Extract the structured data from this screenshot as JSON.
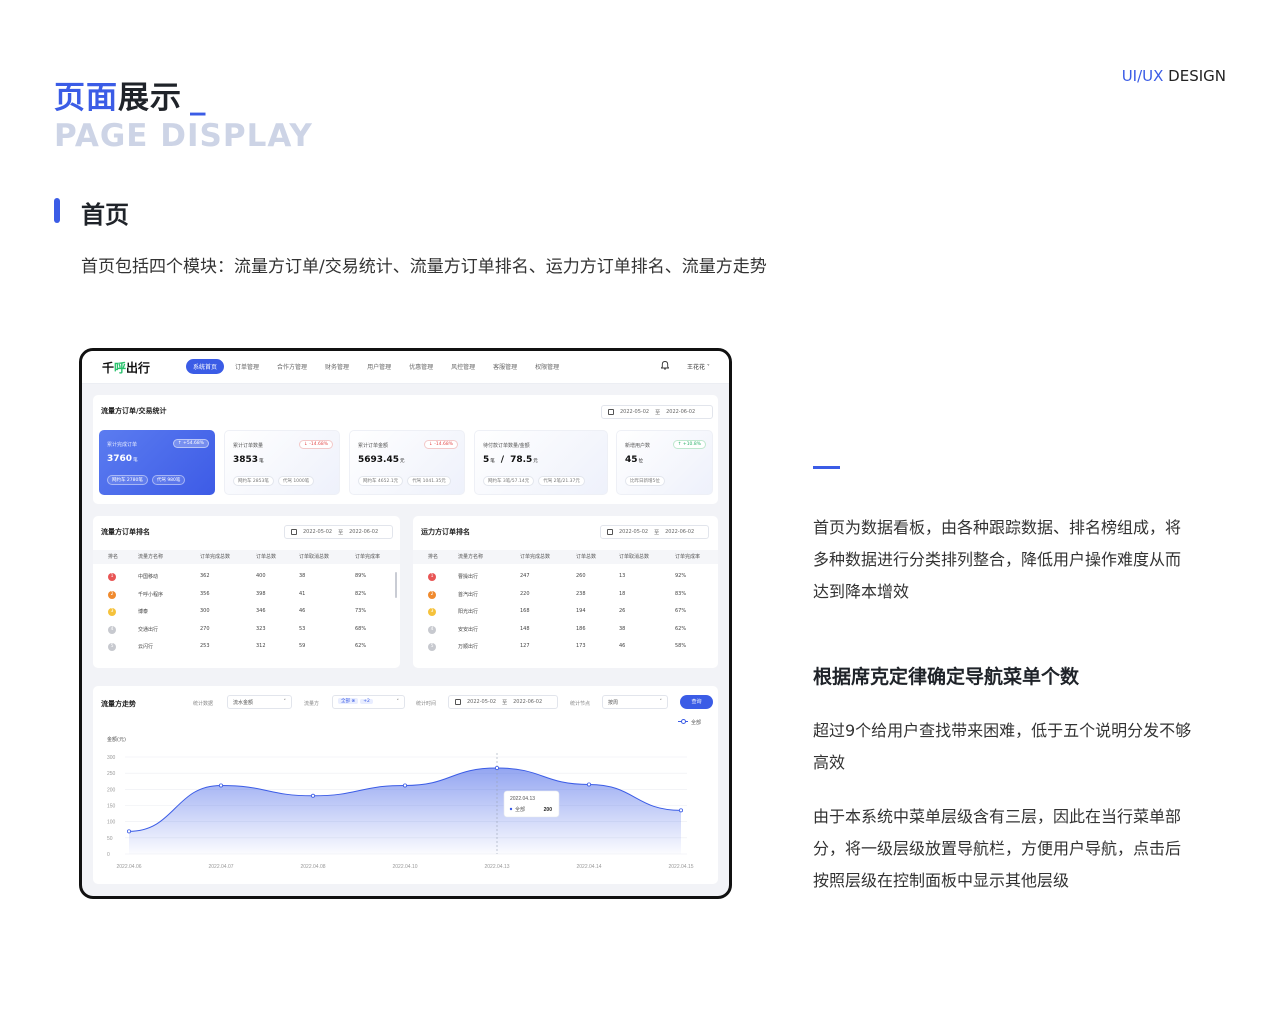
{
  "page": {
    "title_accent": "页面",
    "title_rest": "展示",
    "title_cursor": "_",
    "title_en": "PAGE DISPLAY",
    "brand_blue": "UI/UX",
    "brand_rest": " DESIGN",
    "section_title": "首页",
    "section_desc": "首页包括四个模块：流量方订单/交易统计、流量方订单排名、运力方订单排名、流量方走势",
    "accent_color": "#3b5ce6"
  },
  "side": {
    "p1": "首页为数据看板，由各种跟踪数据、排名榜组成，将多种数据进行分类排列整合，降低用户操作难度从而达到降本增效",
    "heading": "根据席克定律确定导航菜单个数",
    "p2": "超过9个给用户查找带来困难，低于五个说明分发不够高效",
    "p3": "由于本系统中菜单层级含有三层，因此在当行菜单部分，将一级层级放置导航栏，方便用户导航，点击后按照层级在控制面板中显示其他层级"
  },
  "app": {
    "logo_a": "千",
    "logo_b": "呼",
    "logo_c": "出行",
    "nav": [
      "系统首页",
      "订单管理",
      "合作方管理",
      "财务管理",
      "用户管理",
      "优惠管理",
      "风控管理",
      "客服管理",
      "权限管理"
    ],
    "bell_icon": "bell-icon",
    "user": "王花花 ˅",
    "stats": {
      "title": "流量方订单/交易统计",
      "date_from": "2022-05-02",
      "date_sep": "至",
      "date_to": "2022-06-02",
      "cards": [
        {
          "label": "累计完成订单",
          "badge": "↑ +54.68%",
          "value": "3760",
          "unit": "笔",
          "subs": [
            "网约车  2780笔",
            "代驾  980笔"
          ]
        },
        {
          "label": "累计订单数量",
          "badge": "↓ -14.68%",
          "value": "3853",
          "unit": "笔",
          "subs": [
            "网约车  2853笔",
            "代驾  1000笔"
          ]
        },
        {
          "label": "累计订单金额",
          "badge": "↓ -14.68%",
          "value": "5693.45",
          "unit": "元",
          "subs": [
            "网约车  4652.1元",
            "代驾  1041.35元"
          ]
        },
        {
          "label": "待付款订单数量/金额",
          "badge": "",
          "value": "5",
          "unit": "笔",
          "value2": "78.5",
          "unit2": "元",
          "subs": [
            "网约车  3笔/57.14元",
            "代驾  2笔/21.37元"
          ]
        },
        {
          "label": "新增用户数",
          "badge": "↑ +10.8%",
          "value": "45",
          "unit": "位",
          "subs": [
            "比昨日新增5位"
          ]
        }
      ]
    },
    "traffic_rank": {
      "title": "流量方订单排名",
      "date_from": "2022-05-02",
      "date_sep": "至",
      "date_to": "2022-06-02",
      "headers": [
        "排名",
        "流量方名称",
        "订单完成总数",
        "订单总数",
        "订单取消总数",
        "订单完成率"
      ],
      "rows": [
        [
          "1",
          "中国移动",
          "362",
          "400",
          "38",
          "89%"
        ],
        [
          "2",
          "千呼小程序",
          "356",
          "398",
          "41",
          "82%"
        ],
        [
          "3",
          "博泰",
          "300",
          "346",
          "46",
          "73%"
        ],
        [
          "4",
          "交通出行",
          "270",
          "323",
          "53",
          "68%"
        ],
        [
          "5",
          "云闪行",
          "253",
          "312",
          "59",
          "62%"
        ]
      ]
    },
    "capacity_rank": {
      "title": "运力方订单排名",
      "date_from": "2022-05-02",
      "date_sep": "至",
      "date_to": "2022-06-02",
      "headers": [
        "排名",
        "流量方名称",
        "订单完成总数",
        "订单总数",
        "订单取消总数",
        "订单完成率"
      ],
      "rows": [
        [
          "1",
          "曹操出行",
          "247",
          "260",
          "13",
          "92%"
        ],
        [
          "2",
          "首汽出行",
          "220",
          "238",
          "18",
          "83%"
        ],
        [
          "3",
          "阳光出行",
          "168",
          "194",
          "26",
          "67%"
        ],
        [
          "4",
          "安安出行",
          "148",
          "186",
          "38",
          "62%"
        ],
        [
          "5",
          "万顺出行",
          "127",
          "173",
          "46",
          "58%"
        ]
      ]
    },
    "rank_colors": [
      "#e85555",
      "#f08a2e",
      "#f5c23b",
      "#c7c9cf",
      "#c7c9cf"
    ],
    "trend": {
      "title": "流量方走势",
      "f1_label": "统计数据",
      "f1_value": "流水金额",
      "f2_label": "流量方",
      "f2_chip1": "全部 ⊗",
      "f2_chip2": "+2",
      "f3_label": "统计时间",
      "f3_from": "2022-05-02",
      "f3_sep": "至",
      "f3_to": "2022-06-02",
      "f4_label": "统计节点",
      "f4_value": "按周",
      "query": "查询",
      "chevron": "˅",
      "legend": "全部",
      "y_title": "金额(元)",
      "tooltip_date": "2022.04.13",
      "tooltip_name": "全部",
      "tooltip_value": "200"
    }
  },
  "chart_data": {
    "type": "area",
    "title": "流量方走势",
    "ylabel": "金额(元)",
    "categories": [
      "2022.04.06",
      "2022.04.07",
      "2022.04.08",
      "2022.04.10",
      "2022.04.13",
      "2022.04.14",
      "2022.04.15"
    ],
    "series": [
      {
        "name": "全部",
        "values": [
          70,
          212,
          180,
          212,
          266,
          215,
          135
        ],
        "color": "#3b5ce6"
      }
    ],
    "ylim": [
      0,
      300
    ],
    "yticks": [
      0,
      50,
      100,
      150,
      200,
      250,
      300
    ],
    "grid": true,
    "legend": "top-right"
  }
}
